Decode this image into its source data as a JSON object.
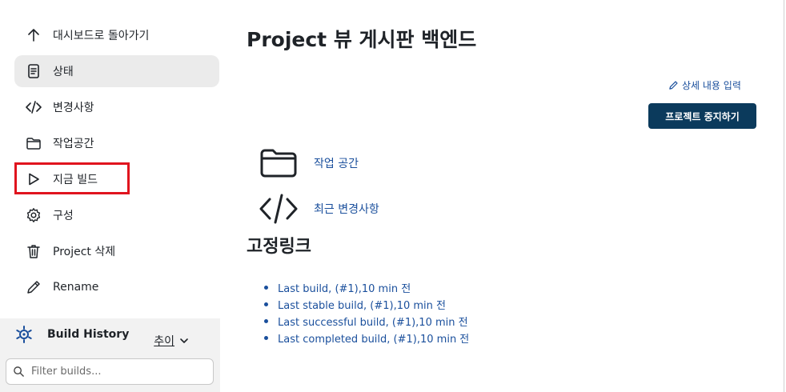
{
  "sidebar": {
    "items": [
      {
        "label": "대시보드로 돌아가기",
        "icon": "arrow-up-icon"
      },
      {
        "label": "상태",
        "icon": "document-icon"
      },
      {
        "label": "변경사항",
        "icon": "code-icon"
      },
      {
        "label": "작업공간",
        "icon": "folder-icon"
      },
      {
        "label": "지금 빌드",
        "icon": "play-icon"
      },
      {
        "label": "구성",
        "icon": "gear-icon"
      },
      {
        "label": "Project 삭제",
        "icon": "trash-icon"
      },
      {
        "label": "Rename",
        "icon": "pencil-icon"
      }
    ],
    "build_history": {
      "title": "Build History",
      "trend": "추이",
      "filter_placeholder": "Filter builds..."
    }
  },
  "main": {
    "title": "Project 뷰 게시판 백엔드",
    "edit_description": "상세 내용 입력",
    "stop_button": "프로젝트 중지하기",
    "links": [
      {
        "label": "작업 공간",
        "icon": "folder-icon"
      },
      {
        "label": "최근 변경사항",
        "icon": "code-icon"
      }
    ],
    "permalinks_title": "고정링크",
    "permalinks": [
      "Last build, (#1),10 min 전",
      "Last stable build, (#1),10 min 전",
      "Last successful build, (#1),10 min 전",
      "Last completed build, (#1),10 min 전"
    ]
  },
  "colors": {
    "link": "#1a4f9c",
    "stop_button_bg": "#0b3a5c",
    "highlight_box": "#e0141e",
    "active_item_bg": "#ebebeb"
  }
}
